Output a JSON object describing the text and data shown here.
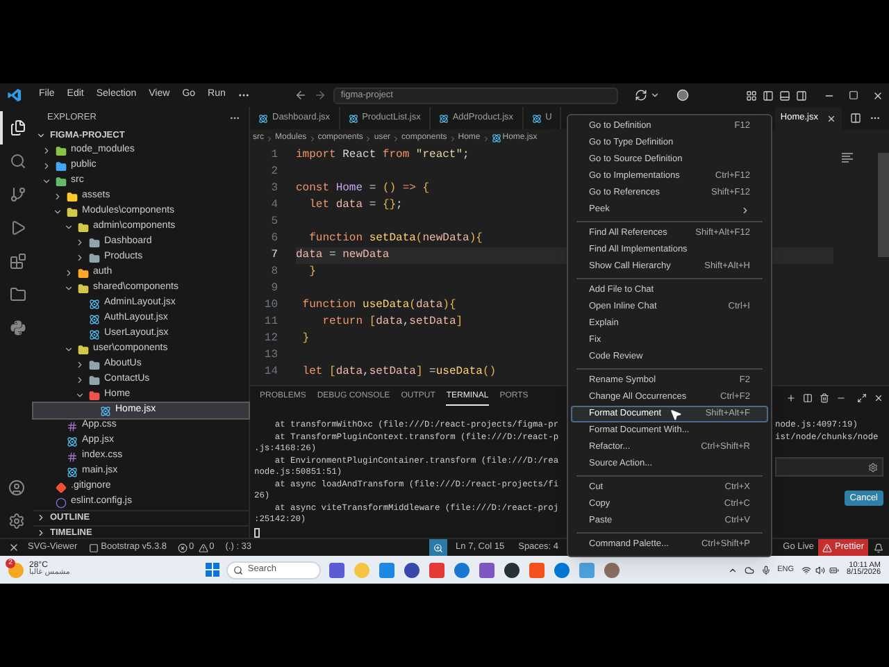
{
  "title_bar": {
    "menus": [
      "File",
      "Edit",
      "Selection",
      "View",
      "Go",
      "Run"
    ],
    "search": "figma-project"
  },
  "activity_bar": {
    "items": [
      {
        "kind": "explorer",
        "selected": true
      },
      {
        "kind": "search",
        "selected": false
      },
      {
        "kind": "source_control",
        "selected": false
      },
      {
        "kind": "run_debug",
        "selected": false
      },
      {
        "kind": "extensions",
        "selected": false
      },
      {
        "kind": "folder",
        "selected": false
      },
      {
        "kind": "python",
        "selected": false
      }
    ],
    "bottom": [
      {
        "kind": "account"
      },
      {
        "kind": "settings"
      }
    ]
  },
  "explorer": {
    "title": "EXPLORER",
    "project": "FIGMA-PROJECT",
    "tree": [
      {
        "label": "node_modules",
        "kind": "folder",
        "color": "#8bc34a",
        "expanded": false,
        "selected": false
      },
      {
        "label": "public",
        "kind": "folder",
        "color": "#42a5f5",
        "expanded": false,
        "selected": false
      },
      {
        "label": "src",
        "kind": "folder",
        "color": "#66bb6a",
        "expanded": true,
        "selected": false,
        "children": [
          {
            "label": "assets",
            "kind": "folder",
            "color": "#ffca28",
            "expanded": false,
            "selected": false
          },
          {
            "label": "Modules\\components",
            "kind": "folder",
            "color": "#d4c84a",
            "expanded": true,
            "selected": false,
            "children": [
              {
                "label": "admin\\components",
                "kind": "folder",
                "color": "#d4c84a",
                "expanded": true,
                "selected": false,
                "children": [
                  {
                    "label": "Dashboard",
                    "kind": "folder",
                    "color": "#90a4ae",
                    "expanded": false,
                    "selected": false
                  },
                  {
                    "label": "Products",
                    "kind": "folder",
                    "color": "#90a4ae",
                    "expanded": false,
                    "selected": false
                  }
                ]
              },
              {
                "label": "auth",
                "kind": "folder",
                "color": "#ffa726",
                "expanded": false,
                "selected": false
              },
              {
                "label": "shared\\components",
                "kind": "folder",
                "color": "#d4c84a",
                "expanded": true,
                "selected": false,
                "children": [
                  {
                    "label": "AdminLayout.jsx",
                    "kind": "react",
                    "selected": false
                  },
                  {
                    "label": "AuthLayout.jsx",
                    "kind": "react",
                    "selected": false
                  },
                  {
                    "label": "UserLayout.jsx",
                    "kind": "react",
                    "selected": false
                  }
                ]
              },
              {
                "label": "user\\components",
                "kind": "folder",
                "color": "#d4c84a",
                "expanded": true,
                "selected": false,
                "children": [
                  {
                    "label": "AboutUs",
                    "kind": "folder",
                    "color": "#90a4ae",
                    "expanded": false,
                    "selected": false
                  },
                  {
                    "label": "ContactUs",
                    "kind": "folder",
                    "color": "#90a4ae",
                    "expanded": false,
                    "selected": false
                  },
                  {
                    "label": "Home",
                    "kind": "folder",
                    "color": "#ef5350",
                    "expanded": true,
                    "selected": false,
                    "children": [
                      {
                        "label": "Home.jsx",
                        "kind": "react",
                        "selected": true
                      }
                    ]
                  }
                ]
              }
            ]
          },
          {
            "label": "App.css",
            "kind": "css",
            "selected": false
          },
          {
            "label": "App.jsx",
            "kind": "react",
            "selected": false
          },
          {
            "label": "index.css",
            "kind": "css",
            "selected": false
          },
          {
            "label": "main.jsx",
            "kind": "react",
            "selected": false
          }
        ]
      },
      {
        "label": ".gitignore",
        "kind": "git",
        "selected": false
      },
      {
        "label": "eslint.config.js",
        "kind": "eslint",
        "selected": false
      }
    ],
    "sections": [
      "OUTLINE",
      "TIMELINE"
    ]
  },
  "editor": {
    "tabs": [
      {
        "label": "Dashboard.jsx",
        "selected": false
      },
      {
        "label": "ProductList.jsx",
        "selected": false
      },
      {
        "label": "AddProduct.jsx",
        "selected": false
      },
      {
        "label": "U",
        "selected": false
      }
    ],
    "right_tabs": [
      {
        "label": "Home.jsx",
        "selected": true
      }
    ],
    "breadcrumb": [
      "src",
      "Modules",
      "components",
      "user",
      "components",
      "Home",
      "Home.jsx"
    ],
    "lines": [
      {
        "number": "1",
        "selected": false,
        "tokens": [
          {
            "kind": "kw",
            "text": "import"
          },
          {
            "kind": "plain",
            "text": " React "
          },
          {
            "kind": "kw",
            "text": "from"
          },
          {
            "kind": "str",
            "text": " \"react\""
          },
          {
            "kind": "plain",
            "text": ";"
          }
        ]
      },
      {
        "number": "2",
        "selected": false
      },
      {
        "number": "3",
        "selected": false,
        "tokens": [
          {
            "kind": "kw",
            "text": "const"
          },
          {
            "kind": "name",
            "text": " Home"
          },
          {
            "kind": "plain",
            "text": " = "
          },
          {
            "kind": "brace",
            "text": "() "
          },
          {
            "kind": "kw",
            "text": "=>"
          },
          {
            "kind": "brace",
            "text": " {"
          }
        ]
      },
      {
        "number": "4",
        "selected": false,
        "tokens": [
          {
            "kind": "kw",
            "text": "  let"
          },
          {
            "kind": "var",
            "text": " data"
          },
          {
            "kind": "plain",
            "text": " = "
          },
          {
            "kind": "brace",
            "text": "{}"
          },
          {
            "kind": "plain",
            "text": ";"
          }
        ]
      },
      {
        "number": "5",
        "selected": false
      },
      {
        "number": "6",
        "selected": false,
        "tokens": [
          {
            "kind": "kw",
            "text": "  function"
          },
          {
            "kind": "fn",
            "text": " setData"
          },
          {
            "kind": "brace",
            "text": "("
          },
          {
            "kind": "var",
            "text": "newData"
          },
          {
            "kind": "brace",
            "text": ")"
          },
          {
            "kind": "brace",
            "text": "{"
          }
        ]
      },
      {
        "number": "7",
        "selected": true,
        "tokens": [
          {
            "kind": "var",
            "text": "data"
          },
          {
            "kind": "plain",
            "text": " = "
          },
          {
            "kind": "var",
            "text": "newData"
          }
        ]
      },
      {
        "number": "8",
        "selected": false,
        "tokens": [
          {
            "kind": "brace",
            "text": "  }"
          }
        ]
      },
      {
        "number": "9",
        "selected": false
      },
      {
        "number": "10",
        "selected": false,
        "tokens": [
          {
            "kind": "kw",
            "text": " function"
          },
          {
            "kind": "fn",
            "text": " useData"
          },
          {
            "kind": "brace",
            "text": "("
          },
          {
            "kind": "var",
            "text": "data"
          },
          {
            "kind": "brace",
            "text": ")"
          },
          {
            "kind": "brace",
            "text": "{"
          }
        ]
      },
      {
        "number": "11",
        "selected": false,
        "tokens": [
          {
            "kind": "kw",
            "text": "    return"
          },
          {
            "kind": "brace",
            "text": " ["
          },
          {
            "kind": "var",
            "text": "data"
          },
          {
            "kind": "plain",
            "text": ","
          },
          {
            "kind": "var",
            "text": "setData"
          },
          {
            "kind": "brace",
            "text": "]"
          }
        ]
      },
      {
        "number": "12",
        "selected": false,
        "tokens": [
          {
            "kind": "brace",
            "text": " }"
          }
        ]
      },
      {
        "number": "13",
        "selected": false
      },
      {
        "number": "14",
        "selected": false,
        "tokens": [
          {
            "kind": "kw",
            "text": " let"
          },
          {
            "kind": "brace",
            "text": " ["
          },
          {
            "kind": "var",
            "text": "data"
          },
          {
            "kind": "plain",
            "text": ","
          },
          {
            "kind": "var",
            "text": "setData"
          },
          {
            "kind": "brace",
            "text": "]"
          },
          {
            "kind": "plain",
            "text": " ="
          },
          {
            "kind": "fn",
            "text": "useData"
          },
          {
            "kind": "brace",
            "text": "()"
          }
        ]
      }
    ]
  },
  "panel": {
    "tabs": [
      {
        "label": "PROBLEMS",
        "selected": false
      },
      {
        "label": "DEBUG CONSOLE",
        "selected": false
      },
      {
        "label": "OUTPUT",
        "selected": false
      },
      {
        "label": "TERMINAL",
        "selected": true
      },
      {
        "label": "PORTS",
        "selected": false
      }
    ],
    "terminal": [
      "    at transformWithOxc (file:///D:/react-projects/figma-pr",
      "    at TransformPluginContext.transform (file:///D:/react-p",
      ".js:4168:26)",
      "    at EnvironmentPluginContainer.transform (file:///D:/rea",
      "node.js:50851:51)",
      "    at async loadAndTransform (file:///D:/react-projects/fi",
      "26)",
      "    at async viteTransformMiddleware (file:///D:/react-proj",
      ":25142:20)"
    ],
    "terminal_right": [
      "node.js:4097:19)",
      "ist/node/chunks/node"
    ],
    "cancel": "Cancel"
  },
  "status_bar": {
    "extensions": [
      "SVG-Viewer",
      "Bootstrap v5.3.8"
    ],
    "errors": "0",
    "warnings": "0",
    "ports": "(.) : 33",
    "position": "Ln 7, Col 15",
    "indent": "Spaces: 4",
    "go_live": "Go Live",
    "prettier": "Prettier"
  },
  "context_menu": {
    "groups": [
      [
        {
          "label": "Go to Definition",
          "shortcut": "F12",
          "submenu": false,
          "selected": false
        },
        {
          "label": "Go to Type Definition",
          "submenu": false,
          "selected": false
        },
        {
          "label": "Go to Source Definition",
          "submenu": false,
          "selected": false
        },
        {
          "label": "Go to Implementations",
          "shortcut": "Ctrl+F12",
          "submenu": false,
          "selected": false
        },
        {
          "label": "Go to References",
          "shortcut": "Shift+F12",
          "submenu": false,
          "selected": false
        },
        {
          "label": "Peek",
          "submenu": true,
          "selected": false
        }
      ],
      [
        {
          "label": "Find All References",
          "shortcut": "Shift+Alt+F12",
          "submenu": false,
          "selected": false
        },
        {
          "label": "Find All Implementations",
          "submenu": false,
          "selected": false
        },
        {
          "label": "Show Call Hierarchy",
          "shortcut": "Shift+Alt+H",
          "submenu": false,
          "selected": false
        }
      ],
      [
        {
          "label": "Add File to Chat",
          "submenu": false,
          "selected": false
        },
        {
          "label": "Open Inline Chat",
          "shortcut": "Ctrl+I",
          "submenu": false,
          "selected": false
        },
        {
          "label": "Explain",
          "submenu": false,
          "selected": false
        },
        {
          "label": "Fix",
          "submenu": false,
          "selected": false
        },
        {
          "label": "Code Review",
          "submenu": false,
          "selected": false
        }
      ],
      [
        {
          "label": "Rename Symbol",
          "shortcut": "F2",
          "submenu": false,
          "selected": false
        },
        {
          "label": "Change All Occurrences",
          "shortcut": "Ctrl+F2",
          "submenu": false,
          "selected": false
        },
        {
          "label": "Format Document",
          "shortcut": "Shift+Alt+F",
          "submenu": false,
          "selected": true
        },
        {
          "label": "Format Document With...",
          "submenu": false,
          "selected": false
        },
        {
          "label": "Refactor...",
          "shortcut": "Ctrl+Shift+R",
          "submenu": false,
          "selected": false
        },
        {
          "label": "Source Action...",
          "submenu": false,
          "selected": false
        }
      ],
      [
        {
          "label": "Cut",
          "shortcut": "Ctrl+X",
          "submenu": false,
          "selected": false
        },
        {
          "label": "Copy",
          "shortcut": "Ctrl+C",
          "submenu": false,
          "selected": false
        },
        {
          "label": "Paste",
          "shortcut": "Ctrl+V",
          "submenu": false,
          "selected": false
        }
      ],
      [
        {
          "label": "Command Palette...",
          "shortcut": "Ctrl+Shift+P",
          "submenu": false,
          "selected": false
        }
      ]
    ]
  },
  "taskbar": {
    "weather": {
      "badge": "2",
      "temperature": "28°C",
      "condition": "مشمس غالبا"
    },
    "search": {
      "placeholder": "Search"
    },
    "language": "ENG",
    "time": "10:11 AM",
    "date": "8/15/2026"
  }
}
